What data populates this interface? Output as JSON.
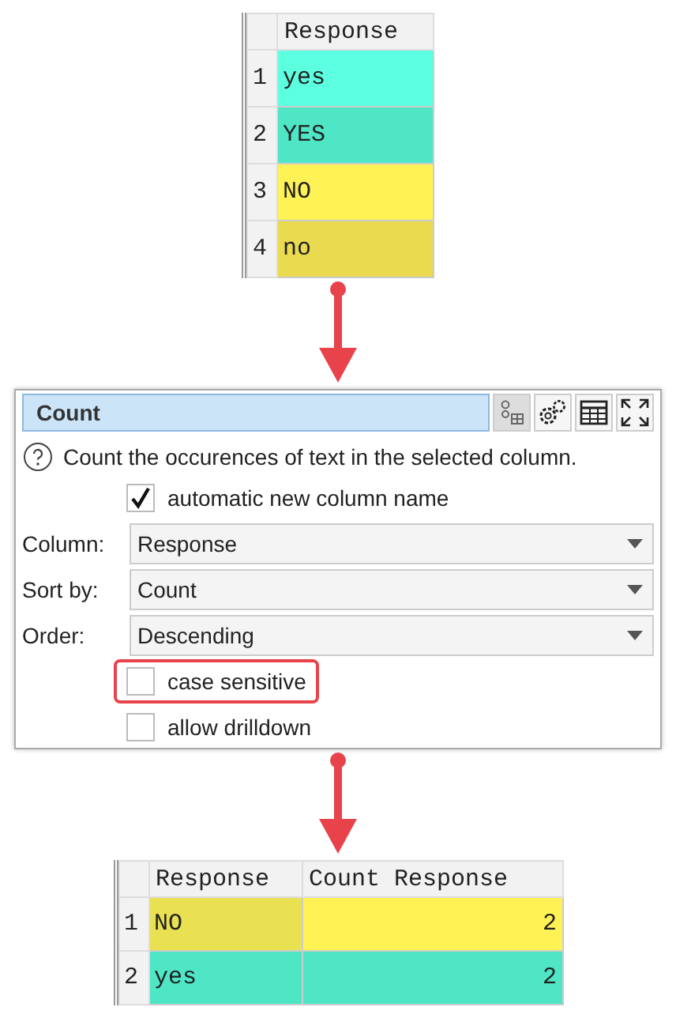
{
  "input_table": {
    "columns": [
      "Response"
    ],
    "rows": [
      {
        "index": "1",
        "cells": [
          {
            "text": "yes",
            "color": "#5cffe0"
          }
        ]
      },
      {
        "index": "2",
        "cells": [
          {
            "text": "YES",
            "color": "#4fe6c6"
          }
        ]
      },
      {
        "index": "3",
        "cells": [
          {
            "text": "NO",
            "color": "#fff255"
          }
        ]
      },
      {
        "index": "4",
        "cells": [
          {
            "text": "no",
            "color": "#e9da50"
          }
        ]
      }
    ]
  },
  "panel": {
    "title": "Count",
    "description": "Count the occurences of text in the selected column.",
    "fields": [
      {
        "kind": "checkbox",
        "label": "automatic new column name",
        "checked": true,
        "highlighted": false
      },
      {
        "kind": "dropdown",
        "label": "Column:",
        "value": "Response"
      },
      {
        "kind": "dropdown",
        "label": "Sort by:",
        "value": "Count"
      },
      {
        "kind": "dropdown",
        "label": "Order:",
        "value": "Descending"
      },
      {
        "kind": "checkbox",
        "label": "case sensitive",
        "checked": false,
        "highlighted": true
      },
      {
        "kind": "checkbox",
        "label": "allow drilldown",
        "checked": false,
        "highlighted": false
      }
    ]
  },
  "output_table": {
    "columns": [
      "Response",
      "Count Response"
    ],
    "rows": [
      {
        "index": "1",
        "cells": [
          {
            "text": "NO",
            "color": "#e9e052"
          },
          {
            "text": "2",
            "color": "#fff255"
          }
        ]
      },
      {
        "index": "2",
        "cells": [
          {
            "text": "yes",
            "color": "#4fe6c6"
          },
          {
            "text": "2",
            "color": "#4fe6c6"
          }
        ]
      }
    ]
  }
}
